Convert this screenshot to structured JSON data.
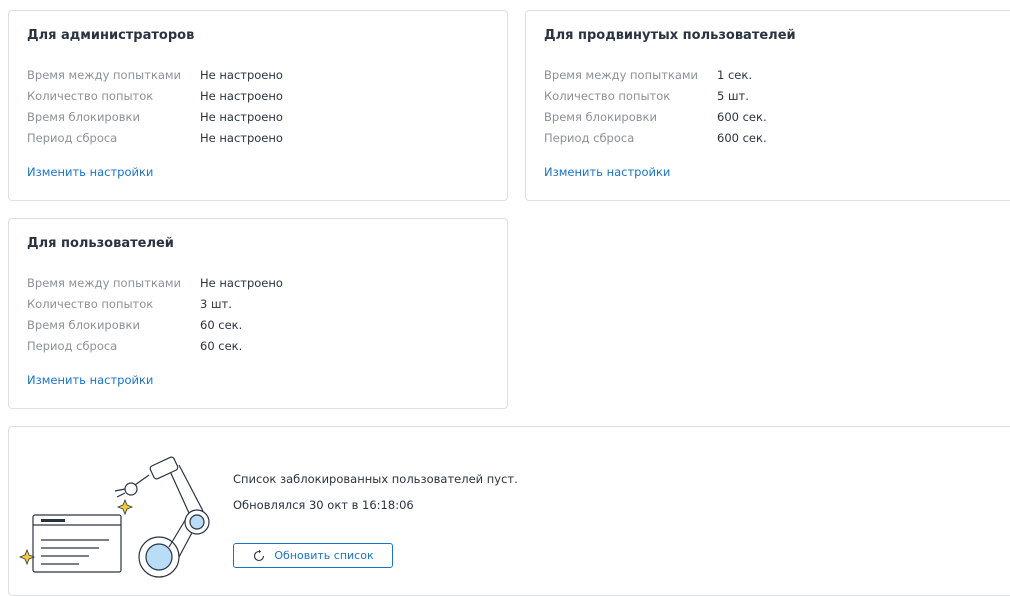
{
  "cards": {
    "admins": {
      "title": "Для администраторов",
      "rows": [
        {
          "label": "Время между попытками",
          "value": "Не настроено"
        },
        {
          "label": "Количество попыток",
          "value": "Не настроено"
        },
        {
          "label": "Время блокировки",
          "value": "Не настроено"
        },
        {
          "label": "Период сброса",
          "value": "Не настроено"
        }
      ],
      "link": "Изменить настройки"
    },
    "advanced": {
      "title": "Для продвинутых пользователей",
      "rows": [
        {
          "label": "Время между попытками",
          "value": "1 сек."
        },
        {
          "label": "Количество попыток",
          "value": "5 шт."
        },
        {
          "label": "Время блокировки",
          "value": "600 сек."
        },
        {
          "label": "Период сброса",
          "value": "600 сек."
        }
      ],
      "link": "Изменить настройки"
    },
    "users": {
      "title": "Для пользователей",
      "rows": [
        {
          "label": "Время между попытками",
          "value": "Не настроено"
        },
        {
          "label": "Количество попыток",
          "value": "3 шт."
        },
        {
          "label": "Время блокировки",
          "value": "60 сек."
        },
        {
          "label": "Период сброса",
          "value": "60 сек."
        }
      ],
      "link": "Изменить настройки"
    }
  },
  "blocked": {
    "empty_text": "Список заблокированных пользователей пуст.",
    "updated_text": "Обновлялся 30 окт в 16:18:06",
    "refresh_label": "Обновить список",
    "refresh_icon": "refresh-icon"
  },
  "colors": {
    "link": "#1a73c8",
    "illustration_accent": "#b9dcf7",
    "sparkle": "#f2cc3d"
  }
}
